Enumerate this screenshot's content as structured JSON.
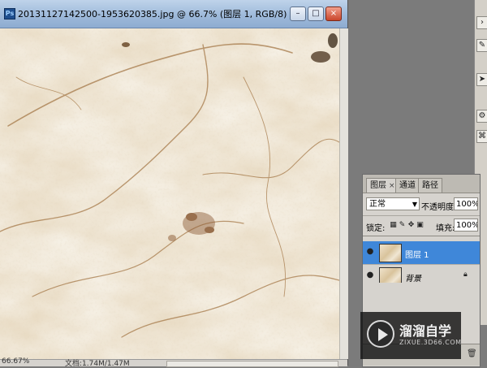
{
  "document": {
    "title": "20131127142500-1953620385.jpg @ 66.7% (图层 1, RGB/8)",
    "zoom": "66.67%",
    "doc_info": "文档:1.74M/1.47M",
    "canvas_image": "marble-texture"
  },
  "window_controls": {
    "minimize": "–",
    "restore": "□",
    "close": "×"
  },
  "tool_strip": {
    "icons": [
      "arrow-icon",
      "brush-icon",
      "gear-icon",
      "tool-icon"
    ]
  },
  "layers_panel": {
    "tabs": [
      {
        "label": "图层",
        "close": "×"
      },
      {
        "label": "通道"
      },
      {
        "label": "路径"
      }
    ],
    "blend_mode": "正常",
    "opacity_label": "不透明度:",
    "opacity_value": "100%",
    "lock_label": "锁定:",
    "fill_label": "填充:",
    "fill_value": "100%",
    "layers": [
      {
        "name": "图层 1",
        "selected": true
      },
      {
        "name": "背景",
        "locked": true
      }
    ]
  },
  "watermark": {
    "brand": "溜溜自学",
    "url": "ZIXUE.3D66.COM"
  },
  "colors": {
    "selection": "#3f87d9",
    "title_gradient": "#9cb8d9",
    "panel_bg": "#d6d3ce"
  }
}
